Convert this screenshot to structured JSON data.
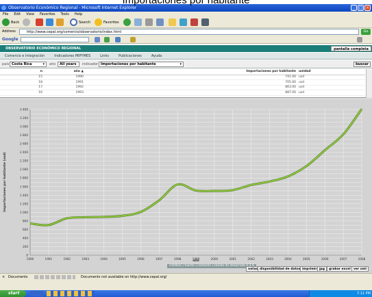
{
  "caption": "Importaciones por habitante",
  "window": {
    "title": "Observatorio Económico Regional - Microsoft Internet Explorer"
  },
  "menu": [
    "File",
    "Edit",
    "View",
    "Favorites",
    "Tools",
    "Help"
  ],
  "toolbar": {
    "back": "Back",
    "search": "Search",
    "favorites": "Favorites"
  },
  "address": {
    "label": "Address",
    "url": "http://www.cepal.org/comercio/observatorio/index.html",
    "go": "Go"
  },
  "google": {
    "label": "Google"
  },
  "site": {
    "header": "OBSERVATORIO ECONÓMICO REGIONAL",
    "fullscreen": "pantalla completa",
    "nav": [
      "Comercio e Integración",
      "Indicadores MIPYMES",
      "Links",
      "Publicaciones",
      "Ayuda"
    ]
  },
  "filters": {
    "pais_label": "país",
    "pais_value": "Costa Rica",
    "ano_label": "año",
    "ano_value": "All years",
    "indicador_label": "indicador",
    "indicador_value": "Importaciones por habitante",
    "buscar": "buscar"
  },
  "table": {
    "columns": [
      "n",
      "año ▲",
      "Importaciones por habitante",
      "unidad"
    ],
    "rows": [
      [
        "15",
        "1990",
        "741.00",
        "usd"
      ],
      [
        "18",
        "1991",
        "705.00",
        "usd"
      ],
      [
        "17",
        "1992",
        "863.00",
        "usd"
      ],
      [
        "16",
        "1993",
        "887.00",
        "usd"
      ]
    ]
  },
  "chart_data": {
    "type": "line",
    "xlabel": "año",
    "ylabel": "Importaciones por habitante (usd)",
    "x": [
      1990,
      1991,
      1992,
      1993,
      1994,
      1995,
      1996,
      1997,
      1998,
      1999,
      2000,
      2001,
      2002,
      2003,
      2004,
      2005,
      2006,
      2007,
      2008
    ],
    "series": [
      {
        "values": [
          741,
          705,
          863,
          887,
          895,
          920,
          1010,
          1280,
          1650,
          1510,
          1500,
          1520,
          1640,
          1720,
          1840,
          2080,
          2450,
          2820,
          3410
        ]
      }
    ],
    "ylim": [
      0,
      3400
    ],
    "yticks": [
      0,
      100,
      200,
      300,
      400,
      500,
      600,
      700,
      800,
      900,
      1000,
      1100,
      1200,
      1300,
      1400,
      1500,
      1600,
      1700,
      1800,
      1900,
      2000,
      2100,
      2200,
      2300,
      2400,
      2500,
      2600,
      2700,
      2800,
      2900,
      3000,
      3100,
      3200,
      3300,
      3400
    ],
    "ytick_labels": [
      "0",
      "",
      "200",
      "",
      "400",
      "",
      "600",
      "",
      "800",
      "",
      "1 000",
      "",
      "1 200",
      "",
      "1 400",
      "",
      "1 600",
      "",
      "1 800",
      "",
      "2 000",
      "",
      "2 200",
      "",
      "2 400",
      "",
      "2 600",
      "",
      "2 800",
      "",
      "3 000",
      "",
      "3 200",
      "",
      "3 400"
    ],
    "grid": true,
    "line_color": "#8cc63f"
  },
  "footer": {
    "credits": "créditos | fuente | contacto | sonido de desarrollo 0.3.9",
    "buttons": [
      "notas",
      "disponibilidad de datos",
      "imprimir",
      "jpg",
      "grabar excel",
      "ver xml"
    ]
  },
  "ie_status": "Documents",
  "ie_status_msg": "Documents not available on http://www.cepal.org/",
  "taskbar": {
    "start": "start",
    "clock": "7:11 PM"
  }
}
